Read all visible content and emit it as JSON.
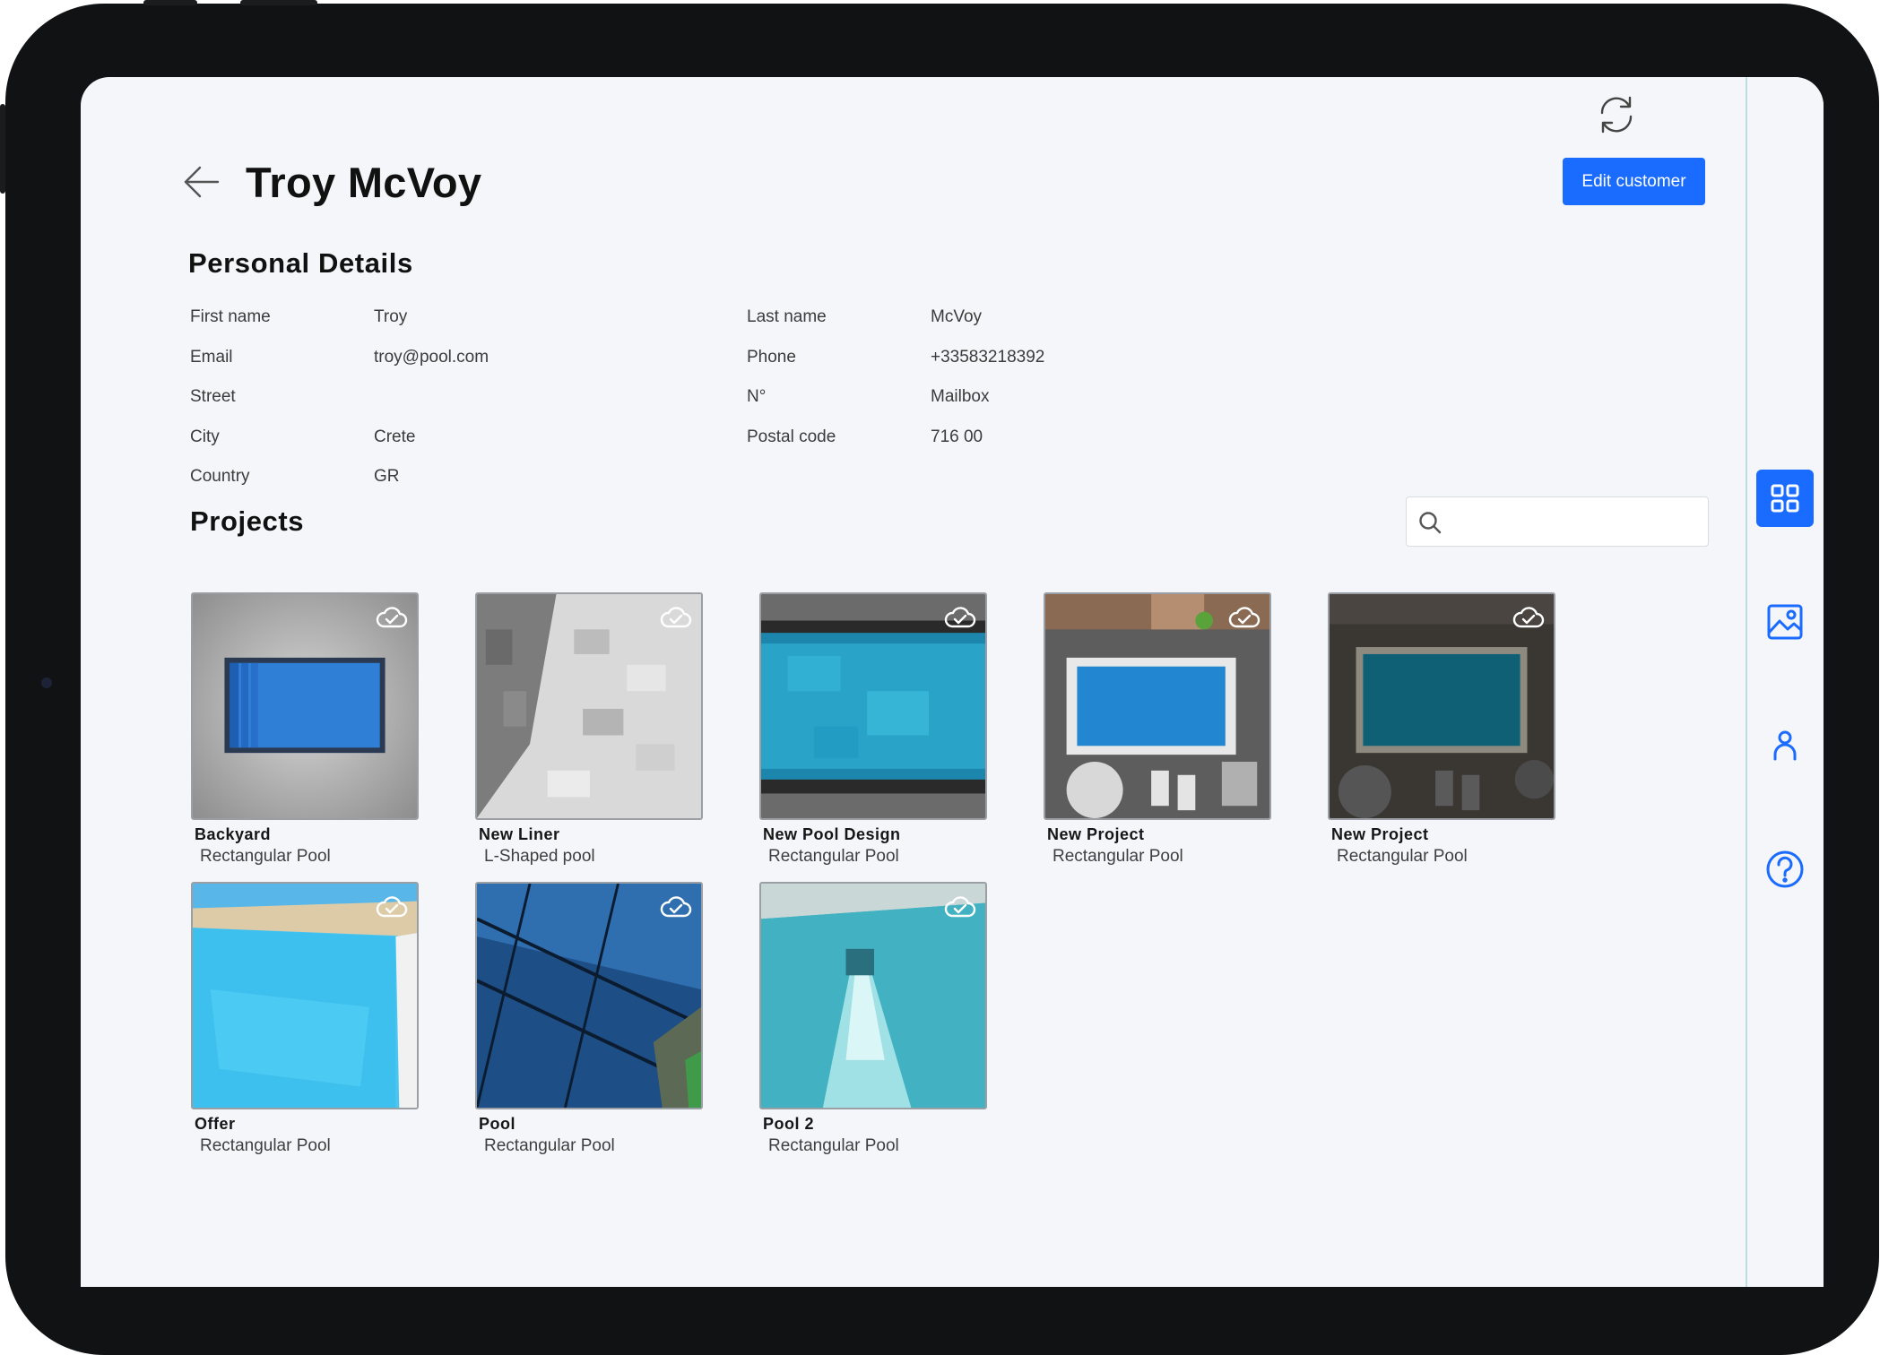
{
  "header": {
    "customer_name": "Troy McVoy",
    "edit_button": "Edit customer"
  },
  "personal_details": {
    "title": "Personal Details",
    "left": [
      {
        "label": "First name",
        "value": "Troy"
      },
      {
        "label": "Email",
        "value": "troy@pool.com"
      },
      {
        "label": "Street",
        "value": ""
      },
      {
        "label": "City",
        "value": "Crete"
      },
      {
        "label": "Country",
        "value": "GR"
      }
    ],
    "right": [
      {
        "label": "Last name",
        "value": "McVoy"
      },
      {
        "label": "Phone",
        "value": "+33583218392"
      },
      {
        "label": "N°",
        "value": "Mailbox"
      },
      {
        "label": "Postal code",
        "value": "716 00"
      }
    ]
  },
  "projects": {
    "title": "Projects",
    "search": {
      "value": "",
      "placeholder": ""
    },
    "items": [
      {
        "name": "Backyard",
        "type": "Rectangular Pool",
        "icon": "cloud-check-icon"
      },
      {
        "name": "New Liner",
        "type": "L-Shaped pool",
        "icon": "cloud-check-icon"
      },
      {
        "name": "New Pool Design",
        "type": "Rectangular Pool",
        "icon": "cloud-check-icon"
      },
      {
        "name": "New Project",
        "type": "Rectangular Pool",
        "icon": "cloud-check-icon"
      },
      {
        "name": "New Project",
        "type": "Rectangular Pool",
        "icon": "cloud-check-icon"
      },
      {
        "name": "Offer",
        "type": "Rectangular Pool",
        "icon": "cloud-check-icon"
      },
      {
        "name": "Pool",
        "type": "Rectangular Pool",
        "icon": "cloud-check-icon"
      },
      {
        "name": "Pool 2",
        "type": "Rectangular Pool",
        "icon": "cloud-check-icon"
      }
    ]
  },
  "rail": {
    "items": [
      {
        "icon": "grid-icon",
        "active": true
      },
      {
        "icon": "image-icon",
        "active": false
      },
      {
        "icon": "person-icon",
        "active": false
      },
      {
        "icon": "help-icon",
        "active": false
      }
    ]
  },
  "colors": {
    "accent": "#1a6bff",
    "background": "#f4f6f9",
    "device_frame": "#111214",
    "rail_border": "#b9dfe4"
  }
}
